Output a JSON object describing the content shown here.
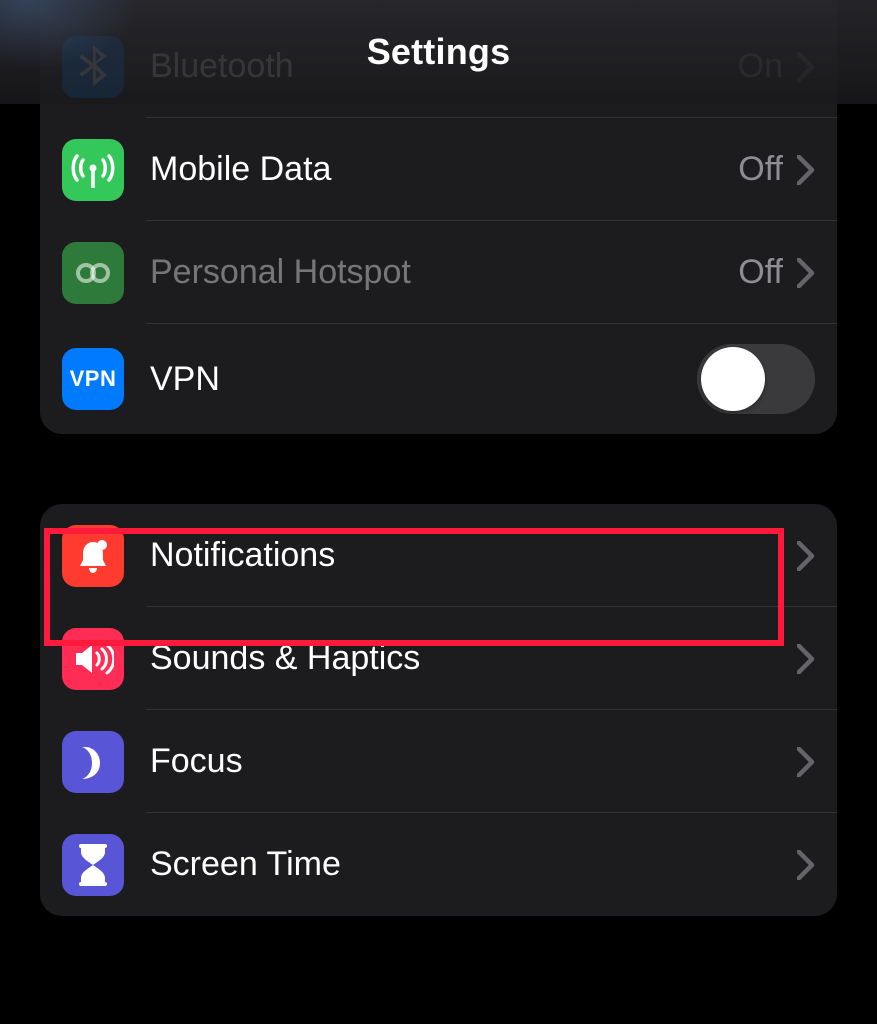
{
  "header": {
    "title": "Settings"
  },
  "groups": [
    {
      "rows": [
        {
          "icon": "bluetooth",
          "icon_bg": "#007aff",
          "label": "Bluetooth",
          "value": "On",
          "accessory": "chevron",
          "disabled": false
        },
        {
          "icon": "antenna",
          "icon_bg": "#34c759",
          "label": "Mobile Data",
          "value": "Off",
          "accessory": "chevron",
          "disabled": false
        },
        {
          "icon": "hotspot",
          "icon_bg": "#2e7a3b",
          "label": "Personal Hotspot",
          "value": "Off",
          "accessory": "chevron",
          "disabled": true
        },
        {
          "icon": "vpn",
          "icon_bg": "#007aff",
          "label": "VPN",
          "value": "",
          "accessory": "switch",
          "switch_on": false,
          "disabled": false
        }
      ]
    },
    {
      "rows": [
        {
          "icon": "bell",
          "icon_bg": "#ff3b30",
          "label": "Notifications",
          "value": "",
          "accessory": "chevron",
          "highlighted": true
        },
        {
          "icon": "speaker",
          "icon_bg": "#ff2d55",
          "label": "Sounds & Haptics",
          "value": "",
          "accessory": "chevron"
        },
        {
          "icon": "moon",
          "icon_bg": "#5856d6",
          "label": "Focus",
          "value": "",
          "accessory": "chevron"
        },
        {
          "icon": "hourglass",
          "icon_bg": "#5856d6",
          "label": "Screen Time",
          "value": "",
          "accessory": "chevron"
        }
      ]
    }
  ],
  "colors": {
    "highlight": "#ff1a3c",
    "group_bg": "#1c1c1e",
    "chevron": "rgba(235,235,245,0.35)"
  }
}
